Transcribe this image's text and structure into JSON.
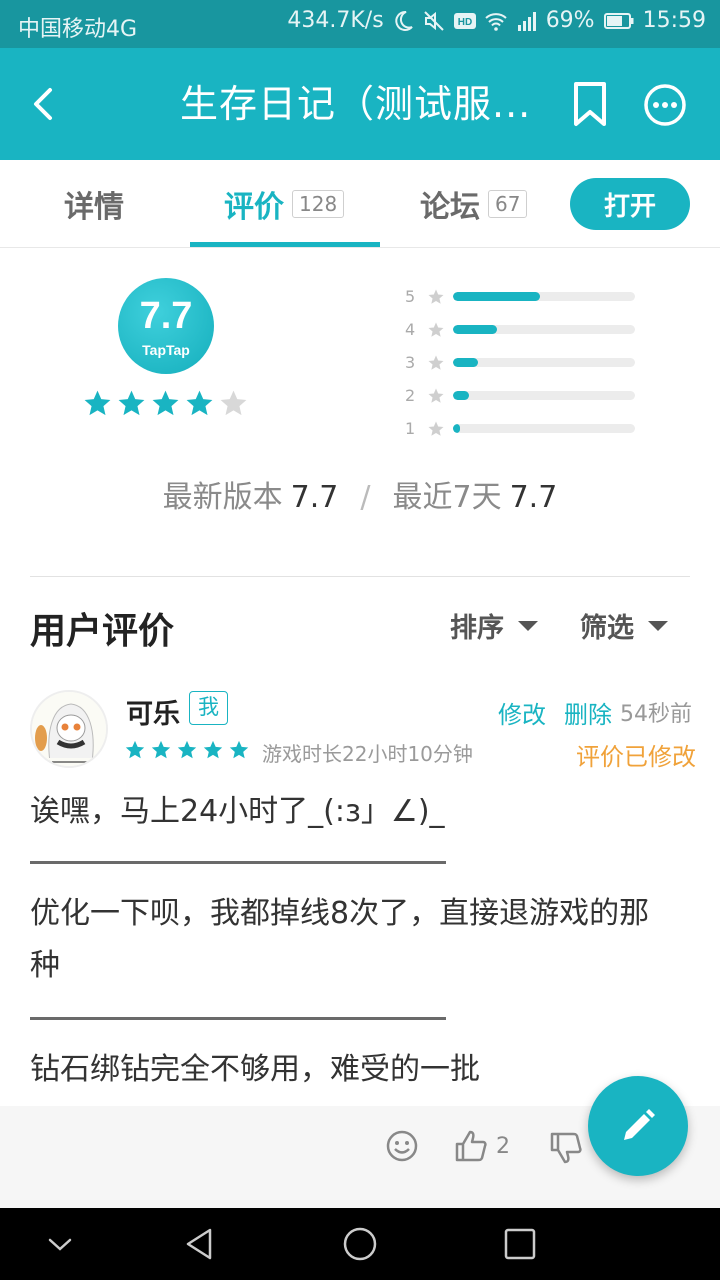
{
  "status_bar": {
    "carrier": "中国移动4G",
    "speed": "434.7K/s",
    "battery": "69%",
    "time": "15:59",
    "icons": [
      "moon-icon",
      "mute-icon",
      "hd-icon",
      "wifi-icon",
      "signal-icon",
      "battery-icon"
    ]
  },
  "app_bar": {
    "title": "生存日记（测试服...",
    "icons": [
      "back-arrow-icon",
      "bookmark-icon",
      "more-icon"
    ]
  },
  "tabs": [
    {
      "label": "详情"
    },
    {
      "label": "评价",
      "count": "128",
      "active": true
    },
    {
      "label": "论坛",
      "count": "67"
    }
  ],
  "open_button": "打开",
  "rating": {
    "score": "7.7",
    "brand": "TapTap",
    "stars": 4,
    "distribution": [
      {
        "label": "5",
        "fraction": 0.48
      },
      {
        "label": "4",
        "fraction": 0.24
      },
      {
        "label": "3",
        "fraction": 0.14
      },
      {
        "label": "2",
        "fraction": 0.09
      },
      {
        "label": "1",
        "fraction": 0.04
      }
    ],
    "latest_version_label": "最新版本",
    "latest_version_value": "7.7",
    "recent_label": "最近7天",
    "recent_value": "7.7",
    "separator": "/"
  },
  "reviews_section": {
    "title": "用户评价",
    "sort_label": "排序",
    "filter_label": "筛选"
  },
  "review": {
    "username": "可乐",
    "me_tag": "我",
    "stars": 5,
    "playtime": "游戏时长22小时10分钟",
    "edit_label": "修改",
    "delete_label": "删除",
    "time_ago": "54秒前",
    "edited_label": "评价已修改",
    "lines": [
      "诶嘿，马上24小时了_(:з」∠)_",
      "优化一下呗，我都掉线8次了，直接退游戏的那",
      "种",
      "钻石绑钻完全不够用，难受的一批"
    ],
    "like_count": "2"
  },
  "colors": {
    "accent": "#19b4c2",
    "status_bar": "#18969f",
    "edited": "#f0a23a"
  }
}
